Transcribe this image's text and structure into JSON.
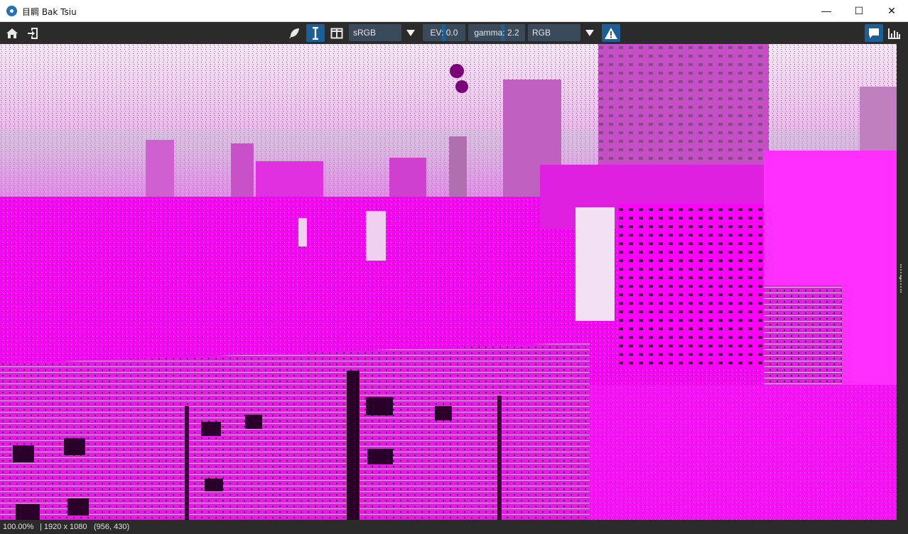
{
  "window": {
    "title": "目睭 Bak Tsiu",
    "minimize_glyph": "—",
    "maximize_glyph": "☐",
    "close_glyph": "✕"
  },
  "toolbar": {
    "left_icons": [
      "home-icon",
      "open-file-icon"
    ],
    "tool_icons": [
      "feather-icon",
      "text-cursor-icon",
      "split-view-icon"
    ],
    "colorspace": "sRGB",
    "ev_label": "EV: 0.0",
    "ev_value": 0.0,
    "gamma_label": "gamma: 2.2",
    "gamma_value": 2.2,
    "channels": "RGB",
    "warning_icon": "warning-icon",
    "right_icons": [
      "comment-icon",
      "histogram-icon"
    ],
    "accent_color": "#1d5f94"
  },
  "image": {
    "description_colors": [
      "#ff00ff",
      "#ffffff",
      "#2a0028"
    ]
  },
  "status": {
    "zoom": "100.00%",
    "size": "| 1920 x 1080",
    "cursor": "(956, 430)"
  }
}
